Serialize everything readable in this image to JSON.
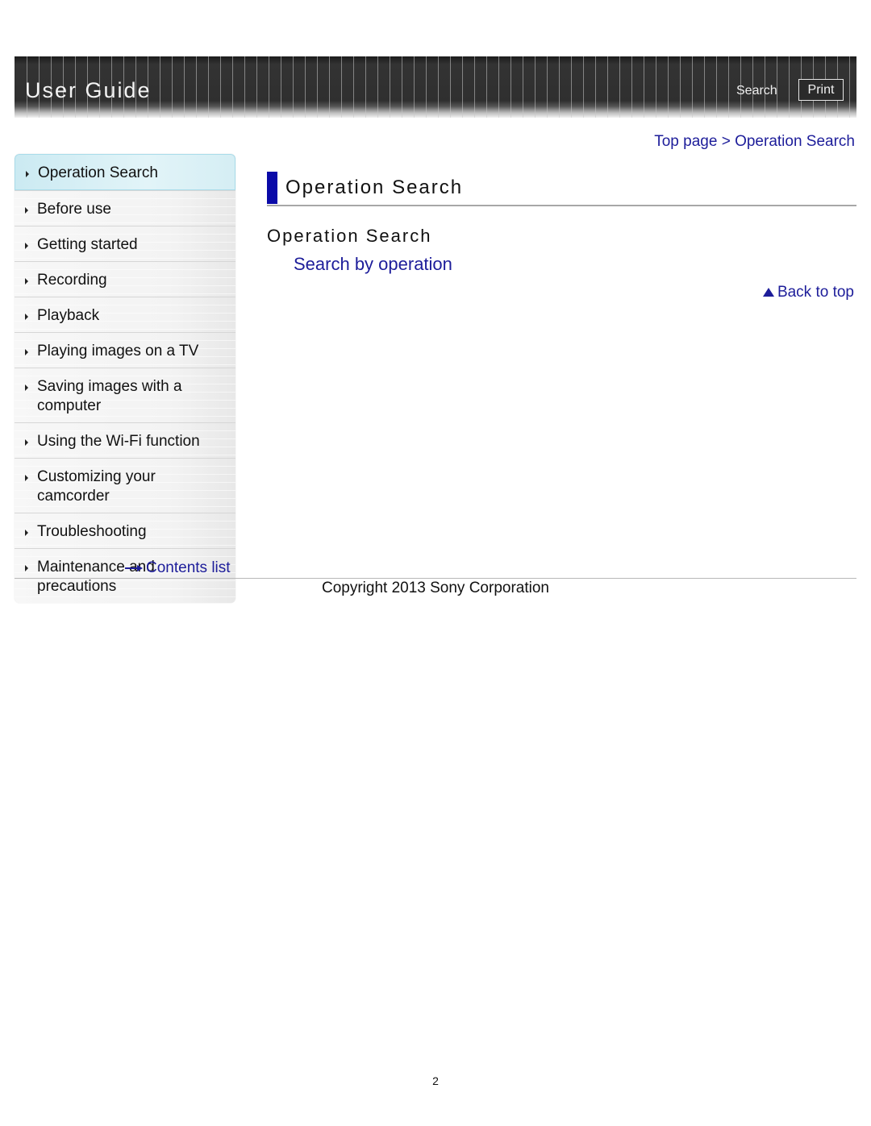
{
  "header": {
    "title": "User Guide",
    "search_label": "Search",
    "print_label": "Print"
  },
  "breadcrumb": {
    "items": [
      "Top page",
      "Operation Search"
    ],
    "separator": ">"
  },
  "sidebar": {
    "items": [
      {
        "label": "Operation Search",
        "active": true
      },
      {
        "label": "Before use"
      },
      {
        "label": "Getting started"
      },
      {
        "label": "Recording"
      },
      {
        "label": "Playback"
      },
      {
        "label": "Playing images on a TV"
      },
      {
        "label": "Saving images with a computer"
      },
      {
        "label": "Using the Wi-Fi function"
      },
      {
        "label": "Customizing your camcorder"
      },
      {
        "label": "Troubleshooting"
      },
      {
        "label": "Maintenance and precautions"
      }
    ],
    "contents_list_label": "Contents list"
  },
  "main": {
    "page_heading": "Operation Search",
    "section_title": "Operation Search",
    "section_link": "Search by operation",
    "back_to_top": "Back to top"
  },
  "footer": {
    "copyright": "Copyright 2013 Sony Corporation",
    "page_number": "2"
  },
  "colors": {
    "link": "#1d1d9a",
    "heading_bar": "#0a0aa8",
    "active_nav": "#cbeaf2"
  }
}
